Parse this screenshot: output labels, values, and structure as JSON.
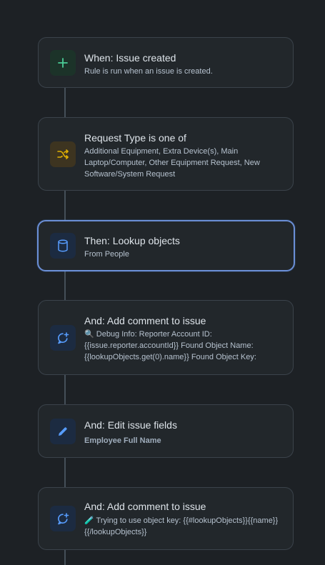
{
  "steps": [
    {
      "title": "When: Issue created",
      "description": "Rule is run when an issue is created."
    },
    {
      "title": "Request Type is one of",
      "description": "Additional Equipment, Extra Device(s), Main Laptop/Computer, Other Equipment Request, New Software/System Request"
    },
    {
      "title": "Then: Lookup objects",
      "description": "From People"
    },
    {
      "title": "And: Add comment to issue",
      "description": "🔍 Debug Info: Reporter Account ID: {{issue.reporter.accountId}} Found Object Name: {{lookupObjects.get(0).name}} Found Object Key:"
    },
    {
      "title": "And: Edit issue fields",
      "description": "Employee Full Name"
    },
    {
      "title": "And: Add comment to issue",
      "description": "🧪 Trying to use object key: {{#lookupObjects}}{{name}}{{/lookupObjects}}"
    }
  ],
  "icons": {
    "trigger": "plus-icon",
    "condition": "shuffle-icon",
    "lookup": "database-icon",
    "comment": "add-comment-icon",
    "edit": "pencil-icon"
  },
  "colors": {
    "background": "#1d2125",
    "card": "#22272b",
    "border": "#3b434b",
    "selected_border": "#6b8fd6",
    "connector": "#454f59",
    "green": "#4bce97",
    "yellow": "#e2b203",
    "blue": "#579dff"
  }
}
